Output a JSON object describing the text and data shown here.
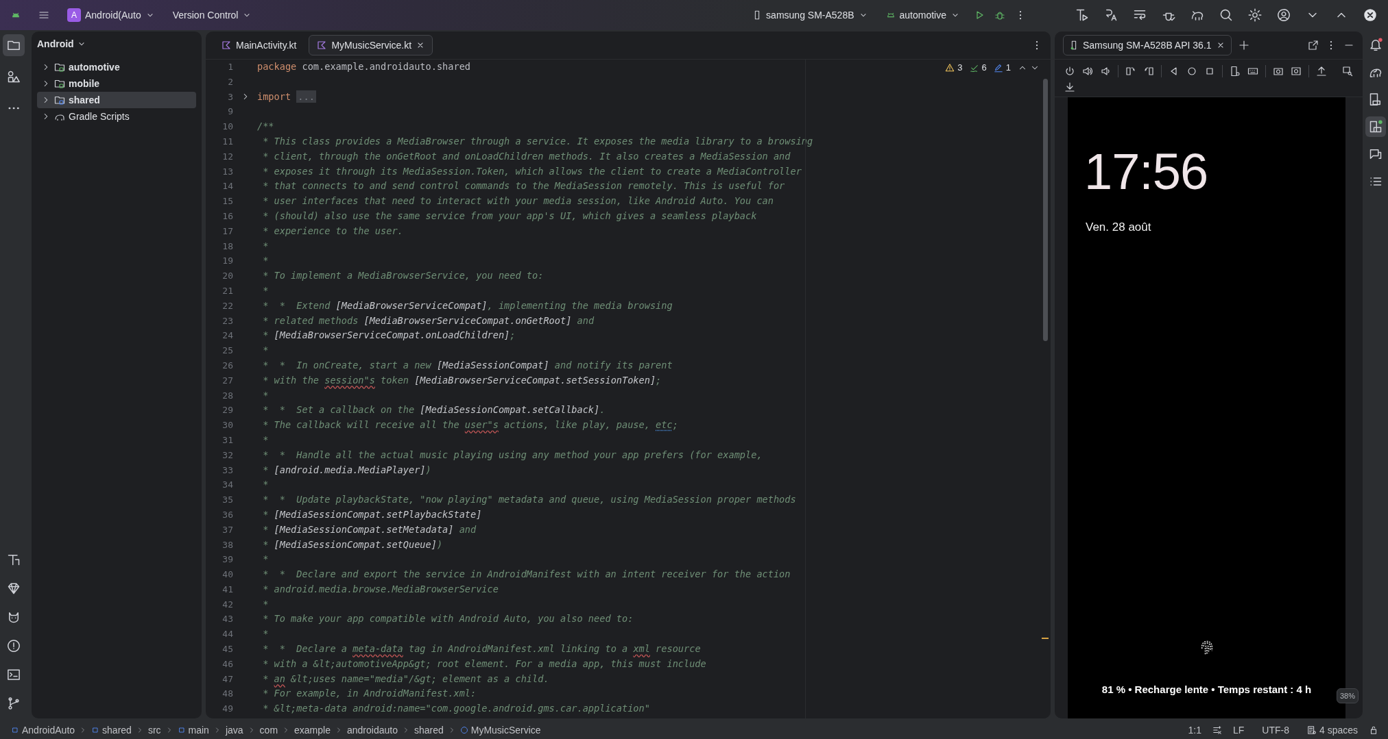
{
  "top_bar": {
    "project_badge": "A",
    "project": "Android(Auto",
    "version_control": "Version Control",
    "device": "samsung SM-A528B",
    "run_config": "automotive"
  },
  "project_panel": {
    "view": "Android",
    "items": [
      {
        "label": "automotive",
        "kind": "module",
        "selected": false
      },
      {
        "label": "mobile",
        "kind": "module",
        "selected": false
      },
      {
        "label": "shared",
        "kind": "library",
        "selected": true
      },
      {
        "label": "Gradle Scripts",
        "kind": "gradle",
        "selected": false
      }
    ]
  },
  "editor": {
    "tabs": [
      {
        "label": "MainActivity.kt",
        "selected": false
      },
      {
        "label": "MyMusicService.kt",
        "selected": true
      }
    ],
    "inspections": {
      "warnings": "3",
      "checks": "6",
      "hints": "1"
    },
    "lines": [
      {
        "number": "1",
        "segments": [
          {
            "kind": "keyword",
            "text": "package"
          },
          {
            "kind": "plain",
            "text": " com.example.androidauto.shared"
          }
        ]
      },
      {
        "number": "2"
      },
      {
        "number": "3",
        "segments": [
          {
            "kind": "keyword",
            "text": "import"
          },
          {
            "kind": "folded",
            "text": "..."
          }
        ]
      },
      {
        "number": "9"
      },
      {
        "number": "10",
        "segments": [
          {
            "kind": "comment",
            "text": "/**"
          }
        ]
      },
      {
        "number": "11",
        "segments": [
          {
            "kind": "comment",
            "text": " * This class provides a MediaBrowser through a service. It exposes the media library to a browsing"
          }
        ]
      },
      {
        "number": "12",
        "segments": [
          {
            "kind": "comment",
            "text": " * client, through the onGetRoot and onLoadChildren methods. It also creates a MediaSession and"
          }
        ]
      },
      {
        "number": "13",
        "segments": [
          {
            "kind": "comment",
            "text": " * exposes it through its MediaSession.Token, which allows the client to create a MediaController"
          }
        ]
      },
      {
        "number": "14",
        "segments": [
          {
            "kind": "comment",
            "text": " * that connects to and send control commands to the MediaSession remotely. This is useful for"
          }
        ]
      },
      {
        "number": "15",
        "segments": [
          {
            "kind": "comment",
            "text": " * user interfaces that need to interact with your media session, like Android Auto. You can"
          }
        ]
      },
      {
        "number": "16",
        "segments": [
          {
            "kind": "comment",
            "text": " * (should) also use the same service from your app's UI, which gives a seamless playback"
          }
        ]
      },
      {
        "number": "17",
        "segments": [
          {
            "kind": "comment",
            "text": " * experience to the user."
          }
        ]
      },
      {
        "number": "18",
        "segments": [
          {
            "kind": "comment",
            "text": " *"
          }
        ]
      },
      {
        "number": "19",
        "segments": [
          {
            "kind": "comment",
            "text": " *"
          }
        ]
      },
      {
        "number": "20",
        "segments": [
          {
            "kind": "comment",
            "text": " * To implement a MediaBrowserService, you need to:"
          }
        ]
      },
      {
        "number": "21",
        "segments": [
          {
            "kind": "comment",
            "text": " *"
          }
        ]
      },
      {
        "number": "22",
        "segments": [
          {
            "kind": "comment",
            "text": " *  *  Extend "
          },
          {
            "kind": "ref",
            "text": "[MediaBrowserServiceCompat]"
          },
          {
            "kind": "comment",
            "text": ", implementing the media browsing"
          }
        ]
      },
      {
        "number": "23",
        "segments": [
          {
            "kind": "comment",
            "text": " * related methods "
          },
          {
            "kind": "ref",
            "text": "[MediaBrowserServiceCompat.onGetRoot]"
          },
          {
            "kind": "comment",
            "text": " and"
          }
        ]
      },
      {
        "number": "24",
        "segments": [
          {
            "kind": "comment",
            "text": " * "
          },
          {
            "kind": "ref",
            "text": "[MediaBrowserServiceCompat.onLoadChildren]"
          },
          {
            "kind": "comment",
            "text": ";"
          }
        ]
      },
      {
        "number": "25",
        "segments": [
          {
            "kind": "comment",
            "text": " *"
          }
        ]
      },
      {
        "number": "26",
        "segments": [
          {
            "kind": "comment",
            "text": " *  *  In onCreate, start a new "
          },
          {
            "kind": "ref",
            "text": "[MediaSessionCompat]"
          },
          {
            "kind": "comment",
            "text": " and notify its parent"
          }
        ]
      },
      {
        "number": "27",
        "segments": [
          {
            "kind": "comment",
            "text": " * with the "
          },
          {
            "kind": "typo",
            "text": "session\"s"
          },
          {
            "kind": "comment",
            "text": " token "
          },
          {
            "kind": "ref",
            "text": "[MediaBrowserServiceCompat.setSessionToken]"
          },
          {
            "kind": "comment",
            "text": ";"
          }
        ]
      },
      {
        "number": "28",
        "segments": [
          {
            "kind": "comment",
            "text": " *"
          }
        ]
      },
      {
        "number": "29",
        "segments": [
          {
            "kind": "comment",
            "text": " *  *  Set a callback on the "
          },
          {
            "kind": "ref",
            "text": "[MediaSessionCompat.setCallback]"
          },
          {
            "kind": "comment",
            "text": "."
          }
        ]
      },
      {
        "number": "30",
        "segments": [
          {
            "kind": "comment",
            "text": " * The callback will receive all the "
          },
          {
            "kind": "typo",
            "text": "user\"s"
          },
          {
            "kind": "comment",
            "text": " actions, like play, pause, "
          },
          {
            "kind": "hint",
            "text": "etc"
          },
          {
            "kind": "comment",
            "text": ";"
          }
        ]
      },
      {
        "number": "31",
        "segments": [
          {
            "kind": "comment",
            "text": " *"
          }
        ]
      },
      {
        "number": "32",
        "segments": [
          {
            "kind": "comment",
            "text": " *  *  Handle all the actual music playing using any method your app prefers (for example,"
          }
        ]
      },
      {
        "number": "33",
        "segments": [
          {
            "kind": "comment",
            "text": " * "
          },
          {
            "kind": "ref",
            "text": "[android.media.MediaPlayer]"
          },
          {
            "kind": "comment",
            "text": ")"
          }
        ]
      },
      {
        "number": "34",
        "segments": [
          {
            "kind": "comment",
            "text": " *"
          }
        ]
      },
      {
        "number": "35",
        "segments": [
          {
            "kind": "comment",
            "text": " *  *  Update playbackState, \"now playing\" metadata and queue, using MediaSession proper methods"
          }
        ]
      },
      {
        "number": "36",
        "segments": [
          {
            "kind": "comment",
            "text": " * "
          },
          {
            "kind": "ref",
            "text": "[MediaSessionCompat.setPlaybackState]"
          }
        ]
      },
      {
        "number": "37",
        "segments": [
          {
            "kind": "comment",
            "text": " * "
          },
          {
            "kind": "ref",
            "text": "[MediaSessionCompat.setMetadata]"
          },
          {
            "kind": "comment",
            "text": " and"
          }
        ]
      },
      {
        "number": "38",
        "segments": [
          {
            "kind": "comment",
            "text": " * "
          },
          {
            "kind": "ref",
            "text": "[MediaSessionCompat.setQueue]"
          },
          {
            "kind": "comment",
            "text": ")"
          }
        ]
      },
      {
        "number": "39",
        "segments": [
          {
            "kind": "comment",
            "text": " *"
          }
        ]
      },
      {
        "number": "40",
        "segments": [
          {
            "kind": "comment",
            "text": " *  *  Declare and export the service in AndroidManifest with an intent receiver for the action"
          }
        ]
      },
      {
        "number": "41",
        "segments": [
          {
            "kind": "comment",
            "text": " * android.media.browse.MediaBrowserService"
          }
        ]
      },
      {
        "number": "42",
        "segments": [
          {
            "kind": "comment",
            "text": " *"
          }
        ]
      },
      {
        "number": "43",
        "segments": [
          {
            "kind": "comment",
            "text": " * To make your app compatible with Android Auto, you also need to:"
          }
        ]
      },
      {
        "number": "44",
        "segments": [
          {
            "kind": "comment",
            "text": " *"
          }
        ]
      },
      {
        "number": "45",
        "segments": [
          {
            "kind": "comment",
            "text": " *  *  Declare a "
          },
          {
            "kind": "typo",
            "text": "meta-data"
          },
          {
            "kind": "comment",
            "text": " tag in AndroidManifest.xml linking to a "
          },
          {
            "kind": "typo",
            "text": "xml"
          },
          {
            "kind": "comment",
            "text": " resource"
          }
        ]
      },
      {
        "number": "46",
        "segments": [
          {
            "kind": "comment",
            "text": " * with a &lt;automotiveApp&gt; root element. For a media app, this must include"
          }
        ]
      },
      {
        "number": "47",
        "segments": [
          {
            "kind": "comment",
            "text": " * "
          },
          {
            "kind": "typo",
            "text": "an"
          },
          {
            "kind": "comment",
            "text": " &lt;uses name=\"media\"/&gt; element as a child."
          }
        ]
      },
      {
        "number": "48",
        "segments": [
          {
            "kind": "comment",
            "text": " * For example, in AndroidManifest.xml:"
          }
        ]
      },
      {
        "number": "49",
        "segments": [
          {
            "kind": "comment",
            "text": " * &lt;meta-data android:name=\"com.google.android.gms.car.application\""
          }
        ]
      }
    ]
  },
  "emulator": {
    "tab": "Samsung SM-A528B API 36.1",
    "time": "17:56",
    "date": "Ven. 28 août",
    "status": "81 % • Recharge lente • Temps restant : 4 h",
    "zoom": "38%"
  },
  "status_bar": {
    "breadcrumbs": [
      {
        "label": "AndroidAuto",
        "kind": "module"
      },
      {
        "label": "shared",
        "kind": "module"
      },
      {
        "label": "src",
        "kind": "folder"
      },
      {
        "label": "main",
        "kind": "module"
      },
      {
        "label": "java",
        "kind": "folder"
      },
      {
        "label": "com",
        "kind": "folder"
      },
      {
        "label": "example",
        "kind": "folder"
      },
      {
        "label": "androidauto",
        "kind": "folder"
      },
      {
        "label": "shared",
        "kind": "folder"
      },
      {
        "label": "MyMusicService",
        "kind": "class"
      }
    ],
    "position": "1:1",
    "line_ending": "LF",
    "encoding": "UTF-8",
    "indent": "4 spaces"
  }
}
